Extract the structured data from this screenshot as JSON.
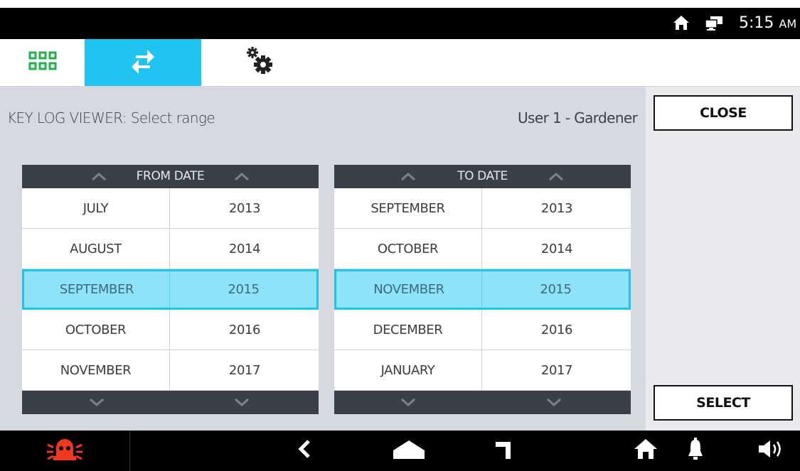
{
  "status_bar": {
    "time": "5:15",
    "ampm": "AM",
    "icons": [
      "home-icon",
      "monitor-icon"
    ]
  },
  "tabs": [
    {
      "name": "apps",
      "icon": "apps-grid-icon"
    },
    {
      "name": "transfer",
      "icon": "transfer-arrows-icon",
      "active": true
    },
    {
      "name": "settings",
      "icon": "gears-icon"
    }
  ],
  "main": {
    "title": "KEY LOG VIEWER: Select range",
    "user": "User 1 - Gardener"
  },
  "from_picker": {
    "header": "FROM DATE",
    "rows": [
      {
        "month": "JULY",
        "year": "2013"
      },
      {
        "month": "AUGUST",
        "year": "2014"
      },
      {
        "month": "SEPTEMBER",
        "year": "2015",
        "selected": true
      },
      {
        "month": "OCTOBER",
        "year": "2016"
      },
      {
        "month": "NOVEMBER",
        "year": "2017"
      }
    ]
  },
  "to_picker": {
    "header": "TO DATE",
    "rows": [
      {
        "month": "SEPTEMBER",
        "year": "2013"
      },
      {
        "month": "OCTOBER",
        "year": "2014"
      },
      {
        "month": "NOVEMBER",
        "year": "2015",
        "selected": true
      },
      {
        "month": "DECEMBER",
        "year": "2016"
      },
      {
        "month": "JANUARY",
        "year": "2017"
      }
    ]
  },
  "side": {
    "close_label": "CLOSE",
    "select_label": "SELECT"
  },
  "nav": {
    "icons": [
      "alarm-icon",
      "back-icon",
      "home-shape-icon",
      "intercom-icon",
      "home-icon",
      "bell-icon",
      "speaker-icon"
    ]
  },
  "colors": {
    "accent": "#1ec3ef",
    "selected_row": "#8fe3f8",
    "picker_header": "#3a4048",
    "alarm": "#f0381e",
    "apps_green": "#22b14c"
  }
}
